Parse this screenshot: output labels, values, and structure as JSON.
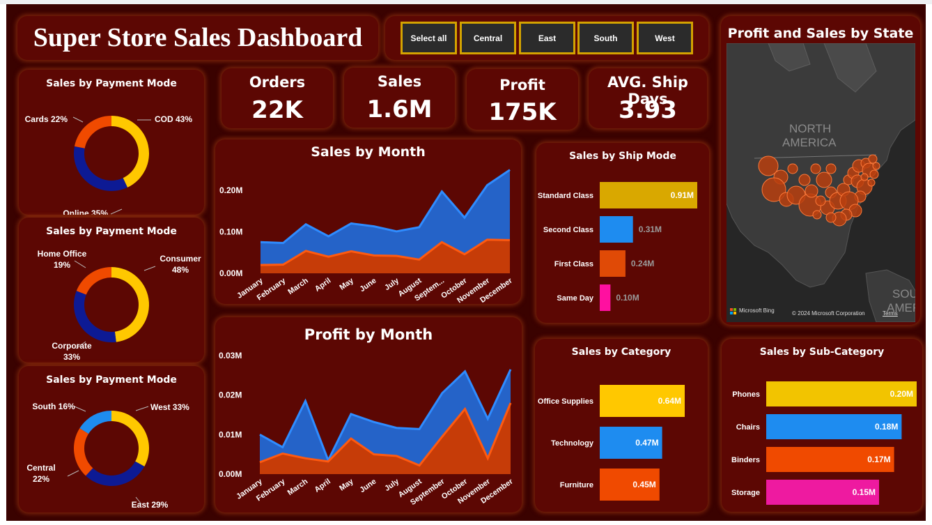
{
  "header": {
    "title": "Super Store Sales Dashboard"
  },
  "slicer": {
    "buttons": [
      "Select all",
      "Central",
      "East",
      "South",
      "West"
    ]
  },
  "kpis": [
    {
      "label": "Orders",
      "value": "22K"
    },
    {
      "label": "Sales",
      "value": "1.6M"
    },
    {
      "label": "Profit",
      "value": "175K"
    },
    {
      "label": "AVG. Ship Days",
      "value": "3.93"
    }
  ],
  "donuts": [
    {
      "title": "Sales by Payment Mode",
      "slices": [
        {
          "label": "COD 43%",
          "value": 43,
          "color": "#ffc800"
        },
        {
          "label": "Online 35%",
          "value": 35,
          "color": "#0d1a94"
        },
        {
          "label": "Cards 22%",
          "value": 22,
          "color": "#f04a00"
        }
      ]
    },
    {
      "title": "Sales by Payment Mode",
      "slices": [
        {
          "label": "Consumer 48%",
          "value": 48,
          "color": "#ffc800"
        },
        {
          "label": "Corporate 33%",
          "value": 33,
          "color": "#0d1a94"
        },
        {
          "label": "Home Office 19%",
          "value": 19,
          "color": "#f04a00"
        }
      ]
    },
    {
      "title": "Sales by Payment Mode",
      "slices": [
        {
          "label": "West 33%",
          "value": 33,
          "color": "#ffc800"
        },
        {
          "label": "East 29%",
          "value": 29,
          "color": "#0d1a94"
        },
        {
          "label": "Central 22%",
          "value": 22,
          "color": "#f04a00"
        },
        {
          "label": "South 16%",
          "value": 16,
          "color": "#1e8cf0"
        }
      ]
    }
  ],
  "map": {
    "title": "Profit and Sales by State",
    "region_labels": [
      "NORTH",
      "AMERICA",
      "SOU",
      "AMER"
    ],
    "attribution": "Microsoft Bing",
    "copyright": "© 2024 Microsoft Corporation",
    "terms": "Terms"
  },
  "chart_data": [
    {
      "type": "area",
      "title": "Sales by Month",
      "categories": [
        "January",
        "February",
        "March",
        "April",
        "May",
        "June",
        "July",
        "August",
        "Septem...",
        "October",
        "November",
        "December"
      ],
      "series": [
        {
          "values": [
            0.075,
            0.073,
            0.118,
            0.089,
            0.12,
            0.113,
            0.101,
            0.111,
            0.197,
            0.134,
            0.212,
            0.249
          ],
          "color": "#2563c8"
        },
        {
          "values": [
            0.02,
            0.021,
            0.054,
            0.04,
            0.053,
            0.043,
            0.042,
            0.033,
            0.075,
            0.046,
            0.081,
            0.08
          ],
          "color": "#c63c08"
        }
      ],
      "yticks": [
        "0.00M",
        "0.10M",
        "0.20M"
      ],
      "ylim": [
        0,
        0.25
      ]
    },
    {
      "type": "area",
      "title": "Profit by Month",
      "categories": [
        "January",
        "February",
        "March",
        "April",
        "May",
        "June",
        "July",
        "August",
        "September",
        "October",
        "November",
        "December"
      ],
      "series": [
        {
          "values": [
            0.01,
            0.0068,
            0.0185,
            0.0035,
            0.0152,
            0.0132,
            0.0117,
            0.0114,
            0.0205,
            0.026,
            0.014,
            0.0265
          ],
          "color": "#2563c8"
        },
        {
          "values": [
            0.003,
            0.0052,
            0.004,
            0.0032,
            0.009,
            0.005,
            0.0046,
            0.0022,
            0.0095,
            0.0165,
            0.004,
            0.018
          ],
          "color": "#c63c08"
        }
      ],
      "yticks": [
        "0.00M",
        "0.01M",
        "0.02M",
        "0.03M"
      ],
      "ylim": [
        0,
        0.03
      ]
    },
    {
      "type": "bar",
      "title": "Sales by Ship Mode",
      "categories": [
        "Standard Class",
        "Second Class",
        "First Class",
        "Same Day"
      ],
      "values": [
        0.91,
        0.31,
        0.24,
        0.1
      ],
      "labels": [
        "0.91M",
        "0.31M",
        "0.24M",
        "0.10M"
      ],
      "colors": [
        "#d9a800",
        "#1e8cf0",
        "#e04a06",
        "#ff10a0"
      ]
    },
    {
      "type": "bar",
      "title": "Sales by Category",
      "categories": [
        "Office Supplies",
        "Technology",
        "Furniture"
      ],
      "values": [
        0.64,
        0.47,
        0.45
      ],
      "labels": [
        "0.64M",
        "0.47M",
        "0.45M"
      ],
      "colors": [
        "#ffc800",
        "#1e8cf0",
        "#f04a00"
      ]
    },
    {
      "type": "bar",
      "title": "Sales by Sub-Category",
      "categories": [
        "Phones",
        "Chairs",
        "Binders",
        "Storage"
      ],
      "values": [
        0.2,
        0.18,
        0.17,
        0.15
      ],
      "labels": [
        "0.20M",
        "0.18M",
        "0.17M",
        "0.15M"
      ],
      "colors": [
        "#f2c400",
        "#1e8cf0",
        "#f04a00",
        "#ee1aa0"
      ]
    }
  ]
}
